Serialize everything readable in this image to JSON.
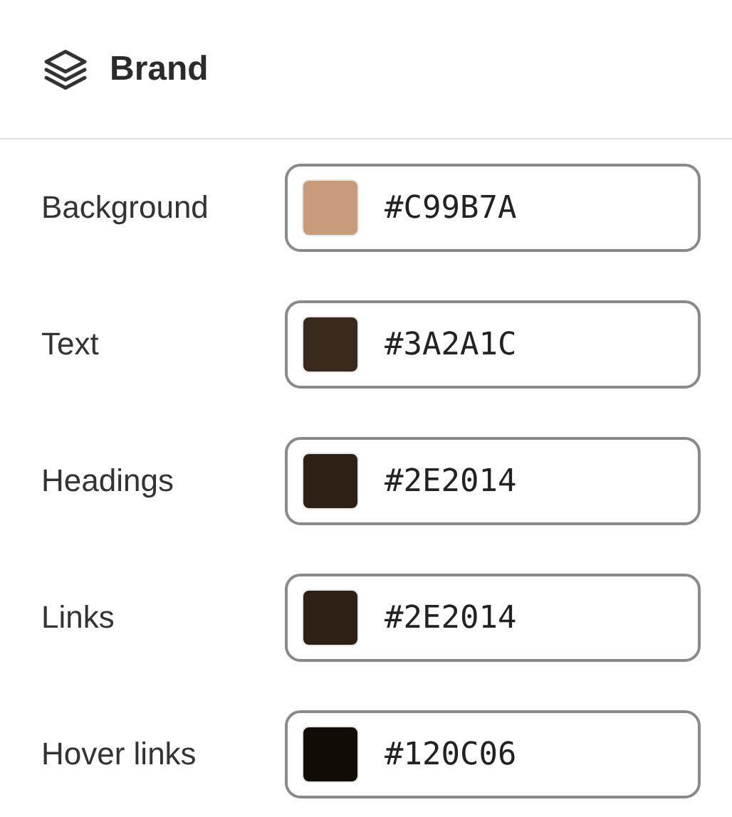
{
  "section": {
    "title": "Brand"
  },
  "colors": [
    {
      "label": "Background",
      "value": "#C99B7A",
      "color": "#c99b7a"
    },
    {
      "label": "Text",
      "value": "#3A2A1C",
      "color": "#3a2a1c"
    },
    {
      "label": "Headings",
      "value": "#2E2014",
      "color": "#2e2014"
    },
    {
      "label": "Links",
      "value": "#2E2014",
      "color": "#2e2014"
    },
    {
      "label": "Hover links",
      "value": "#120C06",
      "color": "#120c06"
    }
  ]
}
